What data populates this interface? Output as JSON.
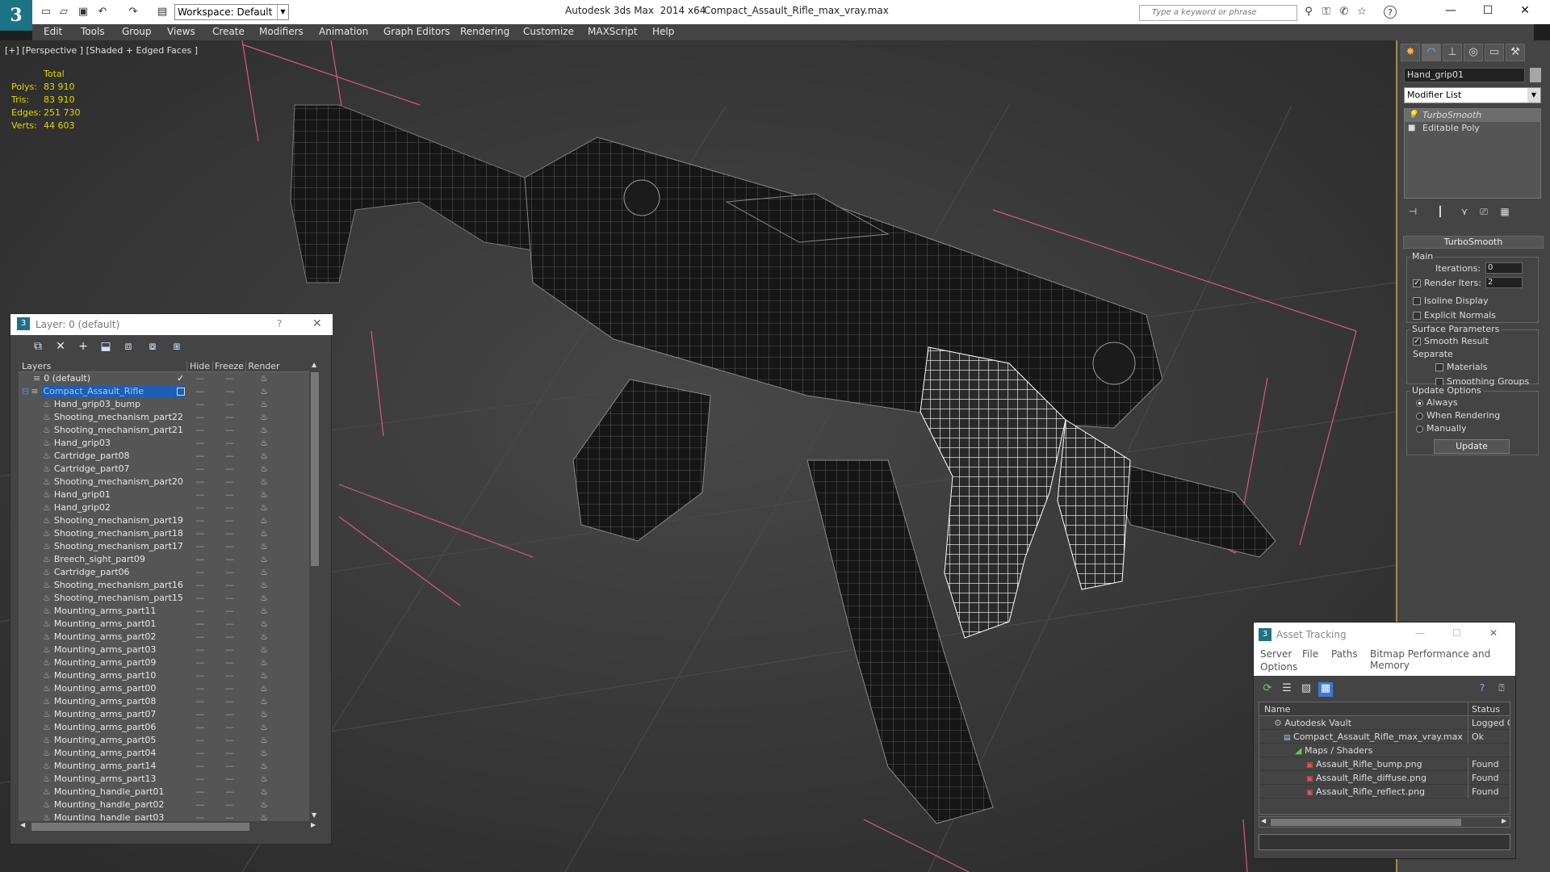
{
  "titlebar": {
    "workspace": "Workspace: Default",
    "app_title": "Autodesk 3ds Max  2014 x64",
    "file_title": "Compact_Assault_Rifle_max_vray.max",
    "search_placeholder": "Type a keyword or phrase",
    "min_glyph": "—",
    "max_glyph": "☐",
    "close_glyph": "✕",
    "logo_glyph": "3"
  },
  "menubar": [
    "Edit",
    "Tools",
    "Group",
    "Views",
    "Create",
    "Modifiers",
    "Animation",
    "Graph Editors",
    "Rendering",
    "Customize",
    "MAXScript",
    "Help"
  ],
  "viewport": {
    "label": "[+] [Perspective ] [Shaded + Edged Faces ]",
    "stats_header": "Total",
    "stats": [
      {
        "label": "Polys:",
        "value": "83 910"
      },
      {
        "label": "Tris:",
        "value": "83 910"
      },
      {
        "label": "Edges:",
        "value": "251 730"
      },
      {
        "label": "Verts:",
        "value": "44 603"
      }
    ]
  },
  "command_panel": {
    "object_name": "Hand_grip01",
    "modifier_list": "Modifier List",
    "stack": [
      "TurboSmooth",
      "Editable Poly"
    ],
    "rollout_title": "TurboSmooth",
    "main_group": "Main",
    "iterations_label": "Iterations:",
    "iterations_value": "0",
    "render_iters_label": "Render Iters:",
    "render_iters_value": "2",
    "isoline": "Isoline Display",
    "explicit_normals": "Explicit Normals",
    "surface_group": "Surface Parameters",
    "smooth_result": "Smooth Result",
    "separate": "Separate",
    "materials": "Materials",
    "smoothing_groups": "Smoothing Groups",
    "update_group": "Update Options",
    "always": "Always",
    "when_rendering": "When Rendering",
    "manually": "Manually",
    "update_button": "Update"
  },
  "layer_panel": {
    "title": "Layer: 0 (default)",
    "help": "?",
    "close": "✕",
    "columns": [
      "Layers",
      "Hide",
      "Freeze",
      "Render"
    ],
    "default_layer": "0 (default)",
    "active_layer": "Compact_Assault_Rifle",
    "objects": [
      "Hand_grip03_bump",
      "Shooting_mechanism_part22",
      "Shooting_mechanism_part21",
      "Hand_grip03",
      "Cartridge_part08",
      "Cartridge_part07",
      "Shooting_mechanism_part20",
      "Hand_grip01",
      "Hand_grip02",
      "Shooting_mechanism_part19",
      "Shooting_mechanism_part18",
      "Shooting_mechanism_part17",
      "Breech_sight_part09",
      "Cartridge_part06",
      "Shooting_mechanism_part16",
      "Shooting_mechanism_part15",
      "Mounting_arms_part11",
      "Mounting_arms_part01",
      "Mounting_arms_part02",
      "Mounting_arms_part03",
      "Mounting_arms_part09",
      "Mounting_arms_part10",
      "Mounting_arms_part00",
      "Mounting_arms_part08",
      "Mounting_arms_part07",
      "Mounting_arms_part06",
      "Mounting_arms_part05",
      "Mounting_arms_part04",
      "Mounting_arms_part14",
      "Mounting_arms_part13",
      "Mounting_handle_part01",
      "Mounting_handle_part02",
      "Mounting_handle_part03"
    ],
    "dash": "—",
    "teapot": "♨"
  },
  "asset_panel": {
    "title": "Asset Tracking",
    "menu": [
      "Server",
      "File",
      "Paths",
      "Bitmap Performance and Memory",
      "Options"
    ],
    "col_name": "Name",
    "col_status": "Status",
    "rows": [
      {
        "name": "Autodesk Vault",
        "status": "Logged O"
      },
      {
        "name": "Compact_Assault_Rifle_max_vray.max",
        "status": "Ok"
      },
      {
        "name": "Maps / Shaders",
        "status": ""
      },
      {
        "name": "Assault_Rifle_bump.png",
        "status": "Found"
      },
      {
        "name": "Assault_Rifle_diffuse.png",
        "status": "Found"
      },
      {
        "name": "Assault_Rifle_reflect.png",
        "status": "Found"
      }
    ]
  }
}
